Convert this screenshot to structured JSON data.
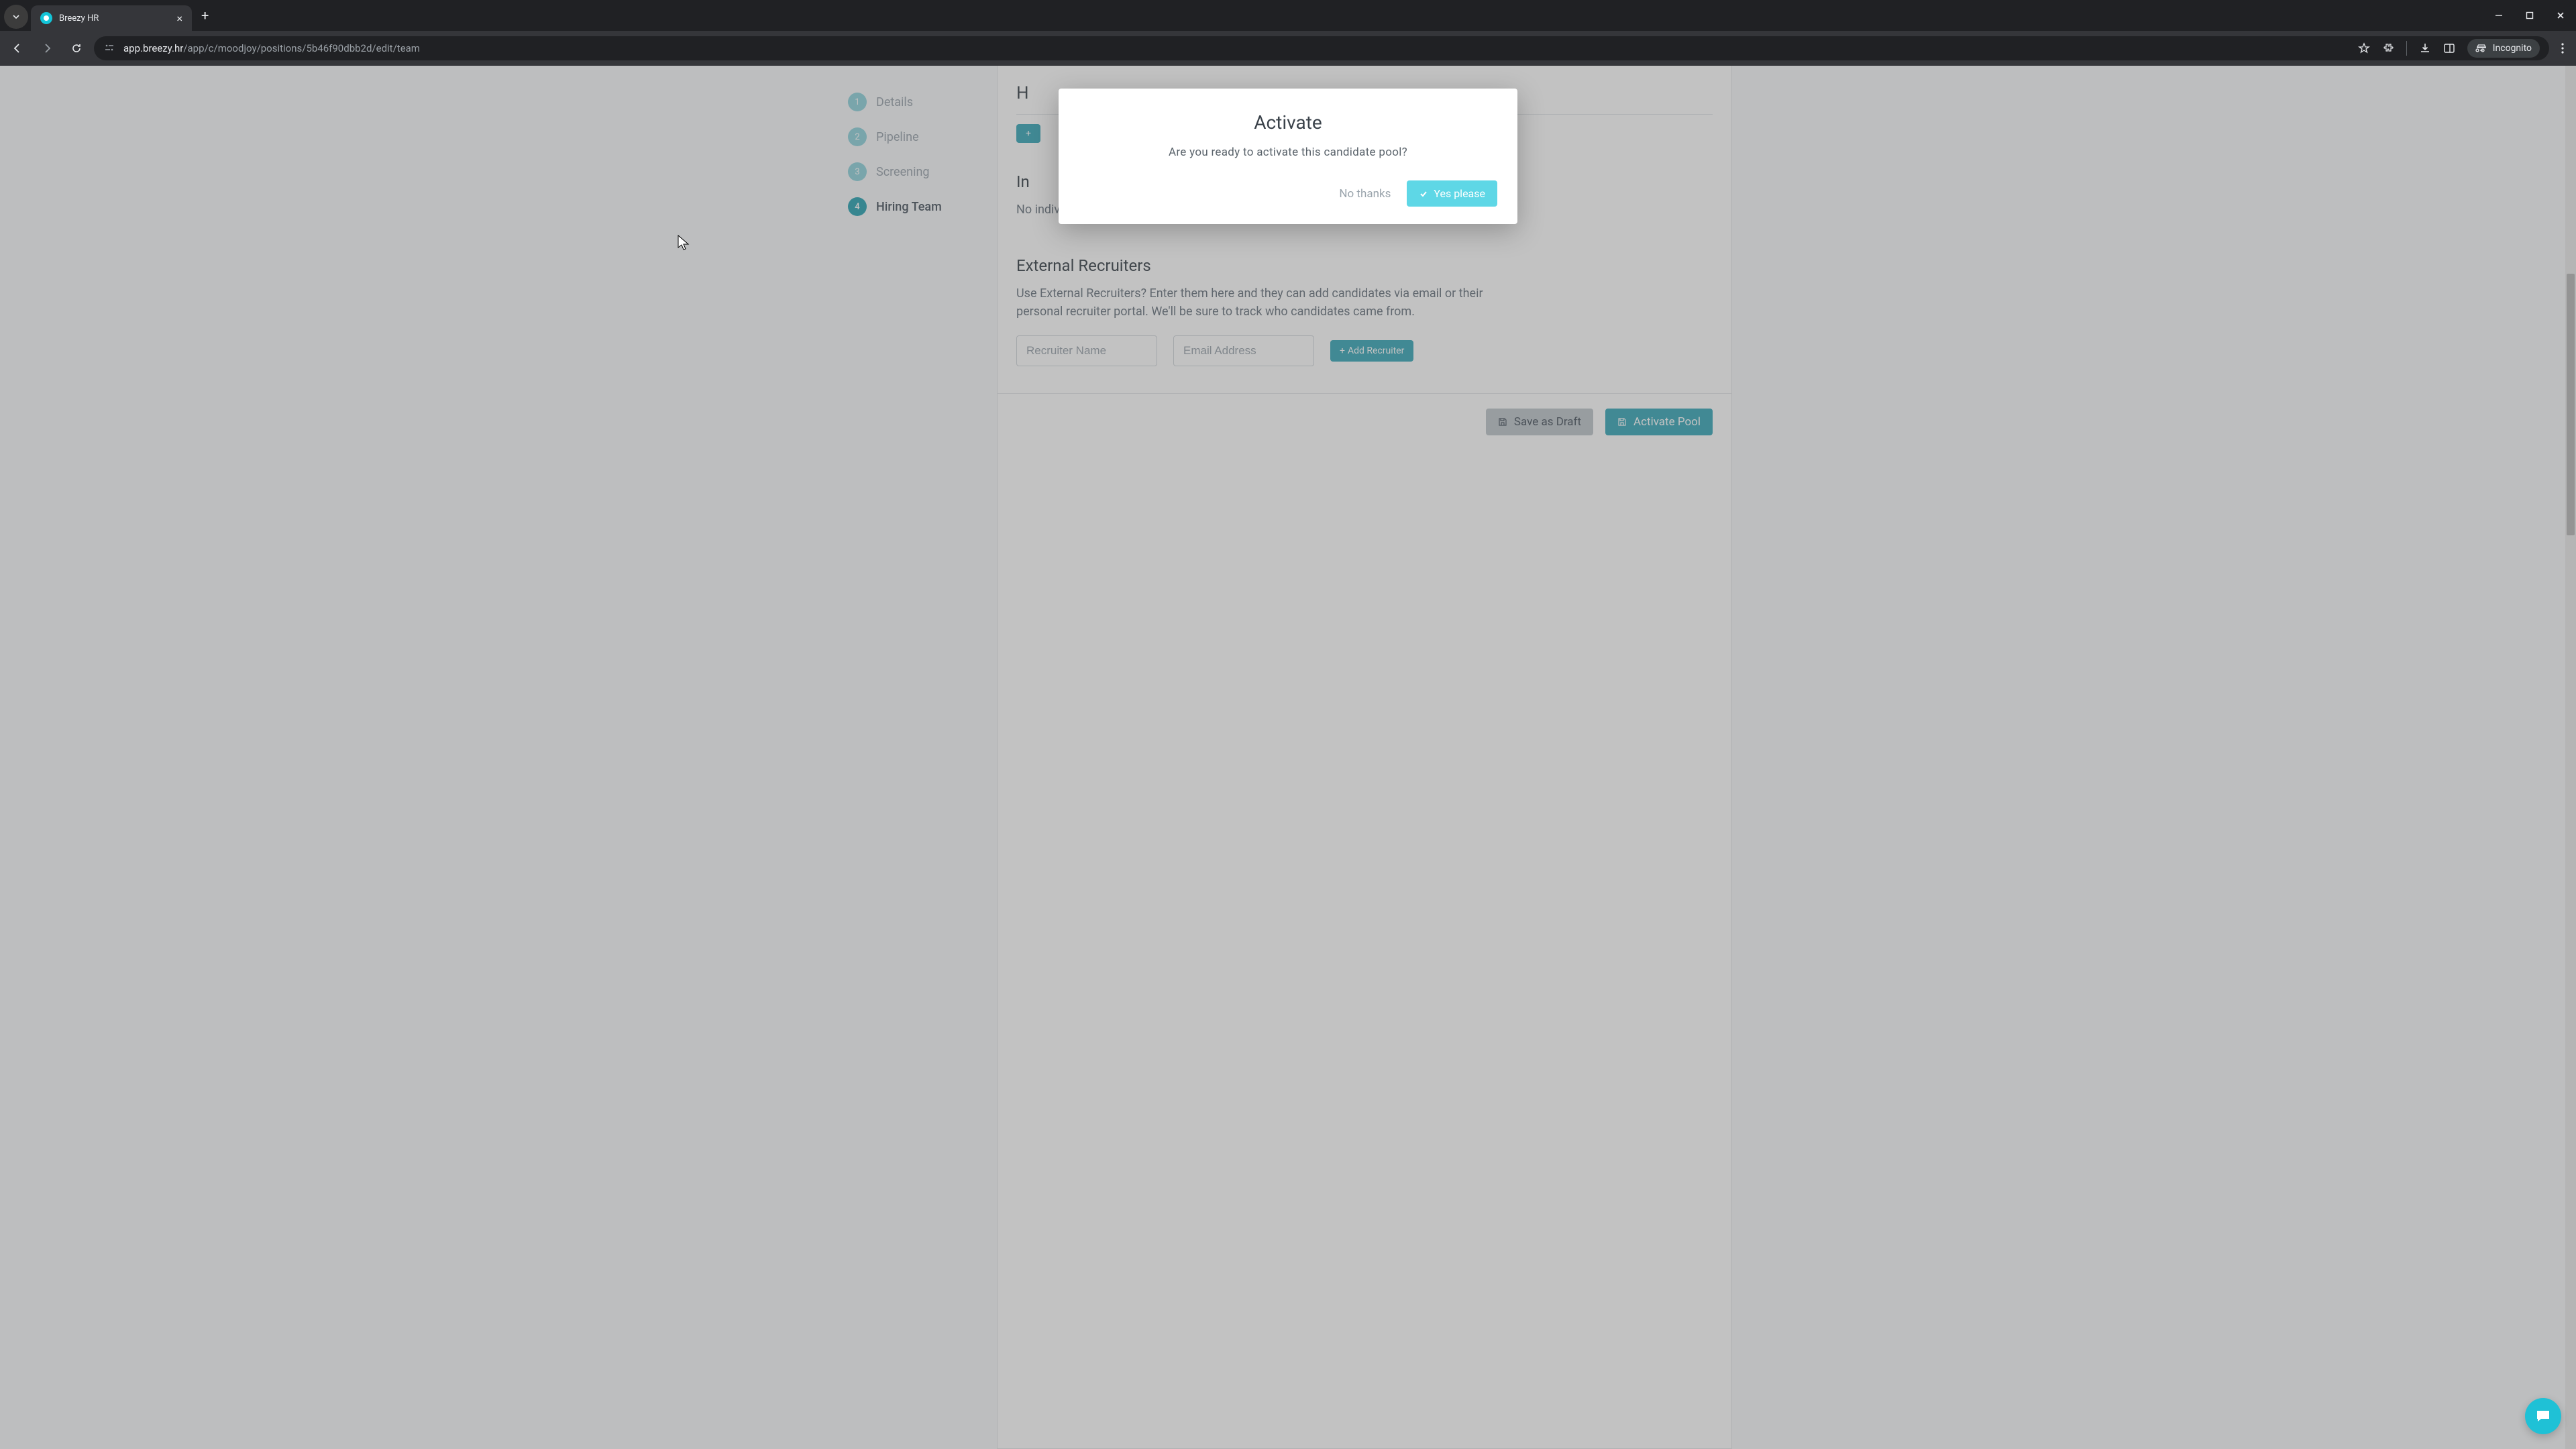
{
  "browser": {
    "tab_title": "Breezy HR",
    "url_host": "app.breezy.hr",
    "url_path": "/app/c/moodjoy/positions/5b46f90dbb2d/edit/team",
    "incognito_label": "Incognito"
  },
  "sidebar": {
    "steps": [
      {
        "num": "1",
        "label": "Details"
      },
      {
        "num": "2",
        "label": "Pipeline"
      },
      {
        "num": "3",
        "label": "Screening"
      },
      {
        "num": "4",
        "label": "Hiring Team"
      }
    ]
  },
  "page": {
    "hiring_title_partial": "H",
    "individual_prefix": "In",
    "individual_empty": "No individual users have been added to this pool.",
    "external_title": "External Recruiters",
    "external_desc": "Use External Recruiters? Enter them here and they can add candidates via email or their personal recruiter portal. We'll be sure to track who candidates came from.",
    "recruiter_name_placeholder": "Recruiter Name",
    "recruiter_email_placeholder": "Email Address",
    "add_recruiter_label": "Add Recruiter",
    "save_draft_label": "Save as Draft",
    "activate_pool_label": "Activate Pool"
  },
  "modal": {
    "title": "Activate",
    "text": "Are you ready to activate this candidate pool?",
    "cancel": "No thanks",
    "confirm": "Yes please"
  }
}
